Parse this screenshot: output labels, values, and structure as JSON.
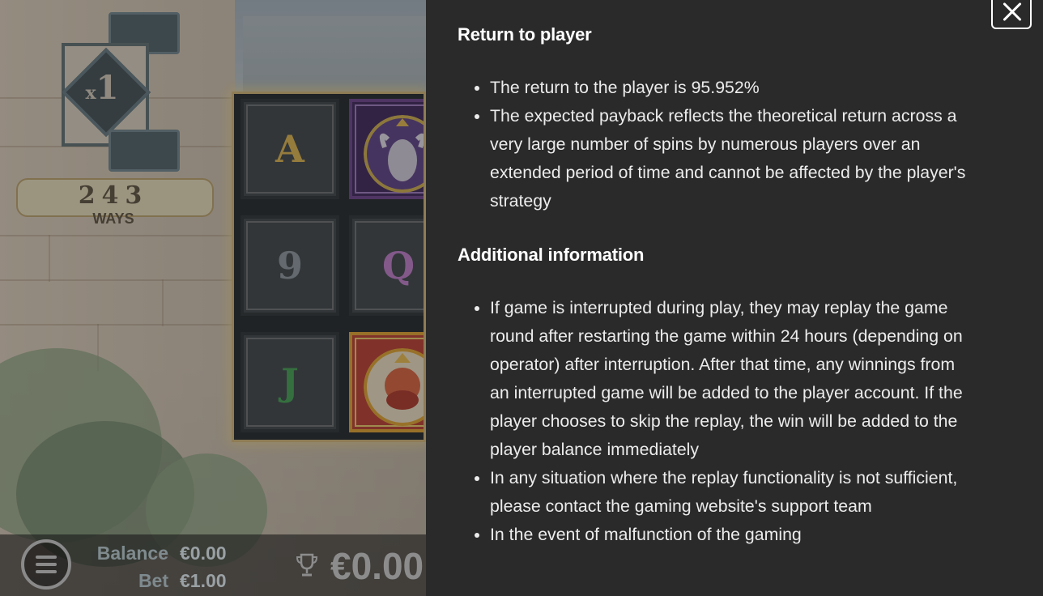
{
  "game": {
    "multiplier": "1",
    "multiplier_prefix": "x",
    "ways_count": "243",
    "ways_label": "WAYS",
    "reels": [
      [
        {
          "symbol": "A",
          "kind": "a"
        },
        {
          "symbol": "9",
          "kind": "n9"
        },
        {
          "symbol": "J",
          "kind": "j"
        }
      ],
      [
        {
          "symbol": "goat",
          "kind": "goat"
        },
        {
          "symbol": "Q",
          "kind": "q"
        },
        {
          "symbol": "king",
          "kind": "king"
        }
      ]
    ]
  },
  "bottom_bar": {
    "balance_label": "Balance",
    "balance_value": "€0.00",
    "bet_label": "Bet",
    "bet_value": "€1.00",
    "win_value": "€0.00",
    "menu_icon": "hamburger-icon",
    "trophy_icon": "trophy-icon"
  },
  "info_panel": {
    "close_icon": "close-icon",
    "sections": [
      {
        "title": "Return to player",
        "items": [
          "The return to the player is 95.952%",
          "The expected payback reflects the theoretical return across a very large number of spins by numerous players over an extended period of time and cannot be affected by the player's strategy"
        ]
      },
      {
        "title": "Additional information",
        "items": [
          "If game is interrupted during play, they may replay the game round after restarting the game within 24 hours (depending on operator) after interruption. After that time, any winnings from an interrupted game will be added to the player account. If the player chooses to skip the replay, the win will be added to the player balance immediately",
          "In any situation where the replay functionality is not sufficient, please contact the gaming website's support team",
          "In the event of malfunction of the gaming"
        ]
      }
    ]
  },
  "colors": {
    "panel_bg": "#2a2a2a",
    "reel_glow": "#d7b877",
    "text_primary": "#ffffff"
  }
}
